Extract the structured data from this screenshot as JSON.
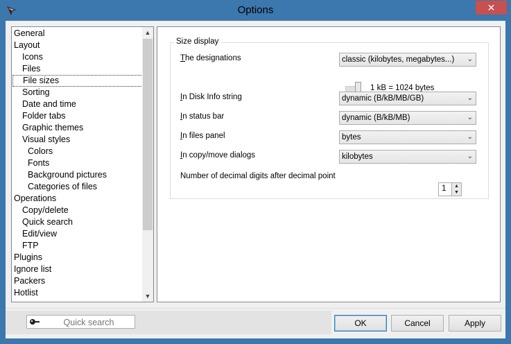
{
  "window": {
    "title": "Options",
    "close_glyph": "✕"
  },
  "tree": {
    "items": [
      {
        "label": "General",
        "level": 0
      },
      {
        "label": "Layout",
        "level": 0
      },
      {
        "label": "Icons",
        "level": 1
      },
      {
        "label": "Files",
        "level": 1
      },
      {
        "label": "File sizes",
        "level": 1,
        "selected": true
      },
      {
        "label": "Sorting",
        "level": 1
      },
      {
        "label": "Date and time",
        "level": 1
      },
      {
        "label": "Folder tabs",
        "level": 1
      },
      {
        "label": "Graphic themes",
        "level": 1
      },
      {
        "label": "Visual styles",
        "level": 1
      },
      {
        "label": "Colors",
        "level": 2
      },
      {
        "label": "Fonts",
        "level": 2
      },
      {
        "label": "Background pictures",
        "level": 2
      },
      {
        "label": "Categories of files",
        "level": 2
      },
      {
        "label": "Operations",
        "level": 0
      },
      {
        "label": "Copy/delete",
        "level": 1
      },
      {
        "label": "Quick search",
        "level": 1
      },
      {
        "label": "Edit/view",
        "level": 1
      },
      {
        "label": "FTP",
        "level": 1
      },
      {
        "label": "Plugins",
        "level": 0
      },
      {
        "label": "Ignore list",
        "level": 0
      },
      {
        "label": "Packers",
        "level": 0
      },
      {
        "label": "Hotlist",
        "level": 0
      }
    ],
    "scroll_up_glyph": "▲",
    "scroll_down_glyph": "▼"
  },
  "size_display": {
    "group_label": "Size display",
    "designations": {
      "label_first": "T",
      "label_rest": "he designations",
      "value": "classic (kilobytes, megabytes...)"
    },
    "kb_text": "1 kB = 1024 bytes",
    "disk_info": {
      "label_first": "I",
      "label_rest": "n Disk Info string",
      "value": "dynamic (B/kB/MB/GB)"
    },
    "status_bar": {
      "label_first": "I",
      "label_rest": "n status bar",
      "value": "dynamic (B/kB/MB)"
    },
    "files_panel": {
      "label_first": "I",
      "label_rest": "n files panel",
      "value": "bytes"
    },
    "copy_move": {
      "label_first": "I",
      "label_rest": "n copy/move dialogs",
      "value": "kilobytes"
    },
    "decimal_digits": {
      "label": "Number of decimal digits after decimal point",
      "value": "1"
    }
  },
  "footer": {
    "search_placeholder": "Quick search",
    "ok_label": "OK",
    "cancel_label": "Cancel",
    "apply_label": "Apply"
  },
  "colors": {
    "titlebar": "#3c77ad",
    "close": "#c75050"
  }
}
